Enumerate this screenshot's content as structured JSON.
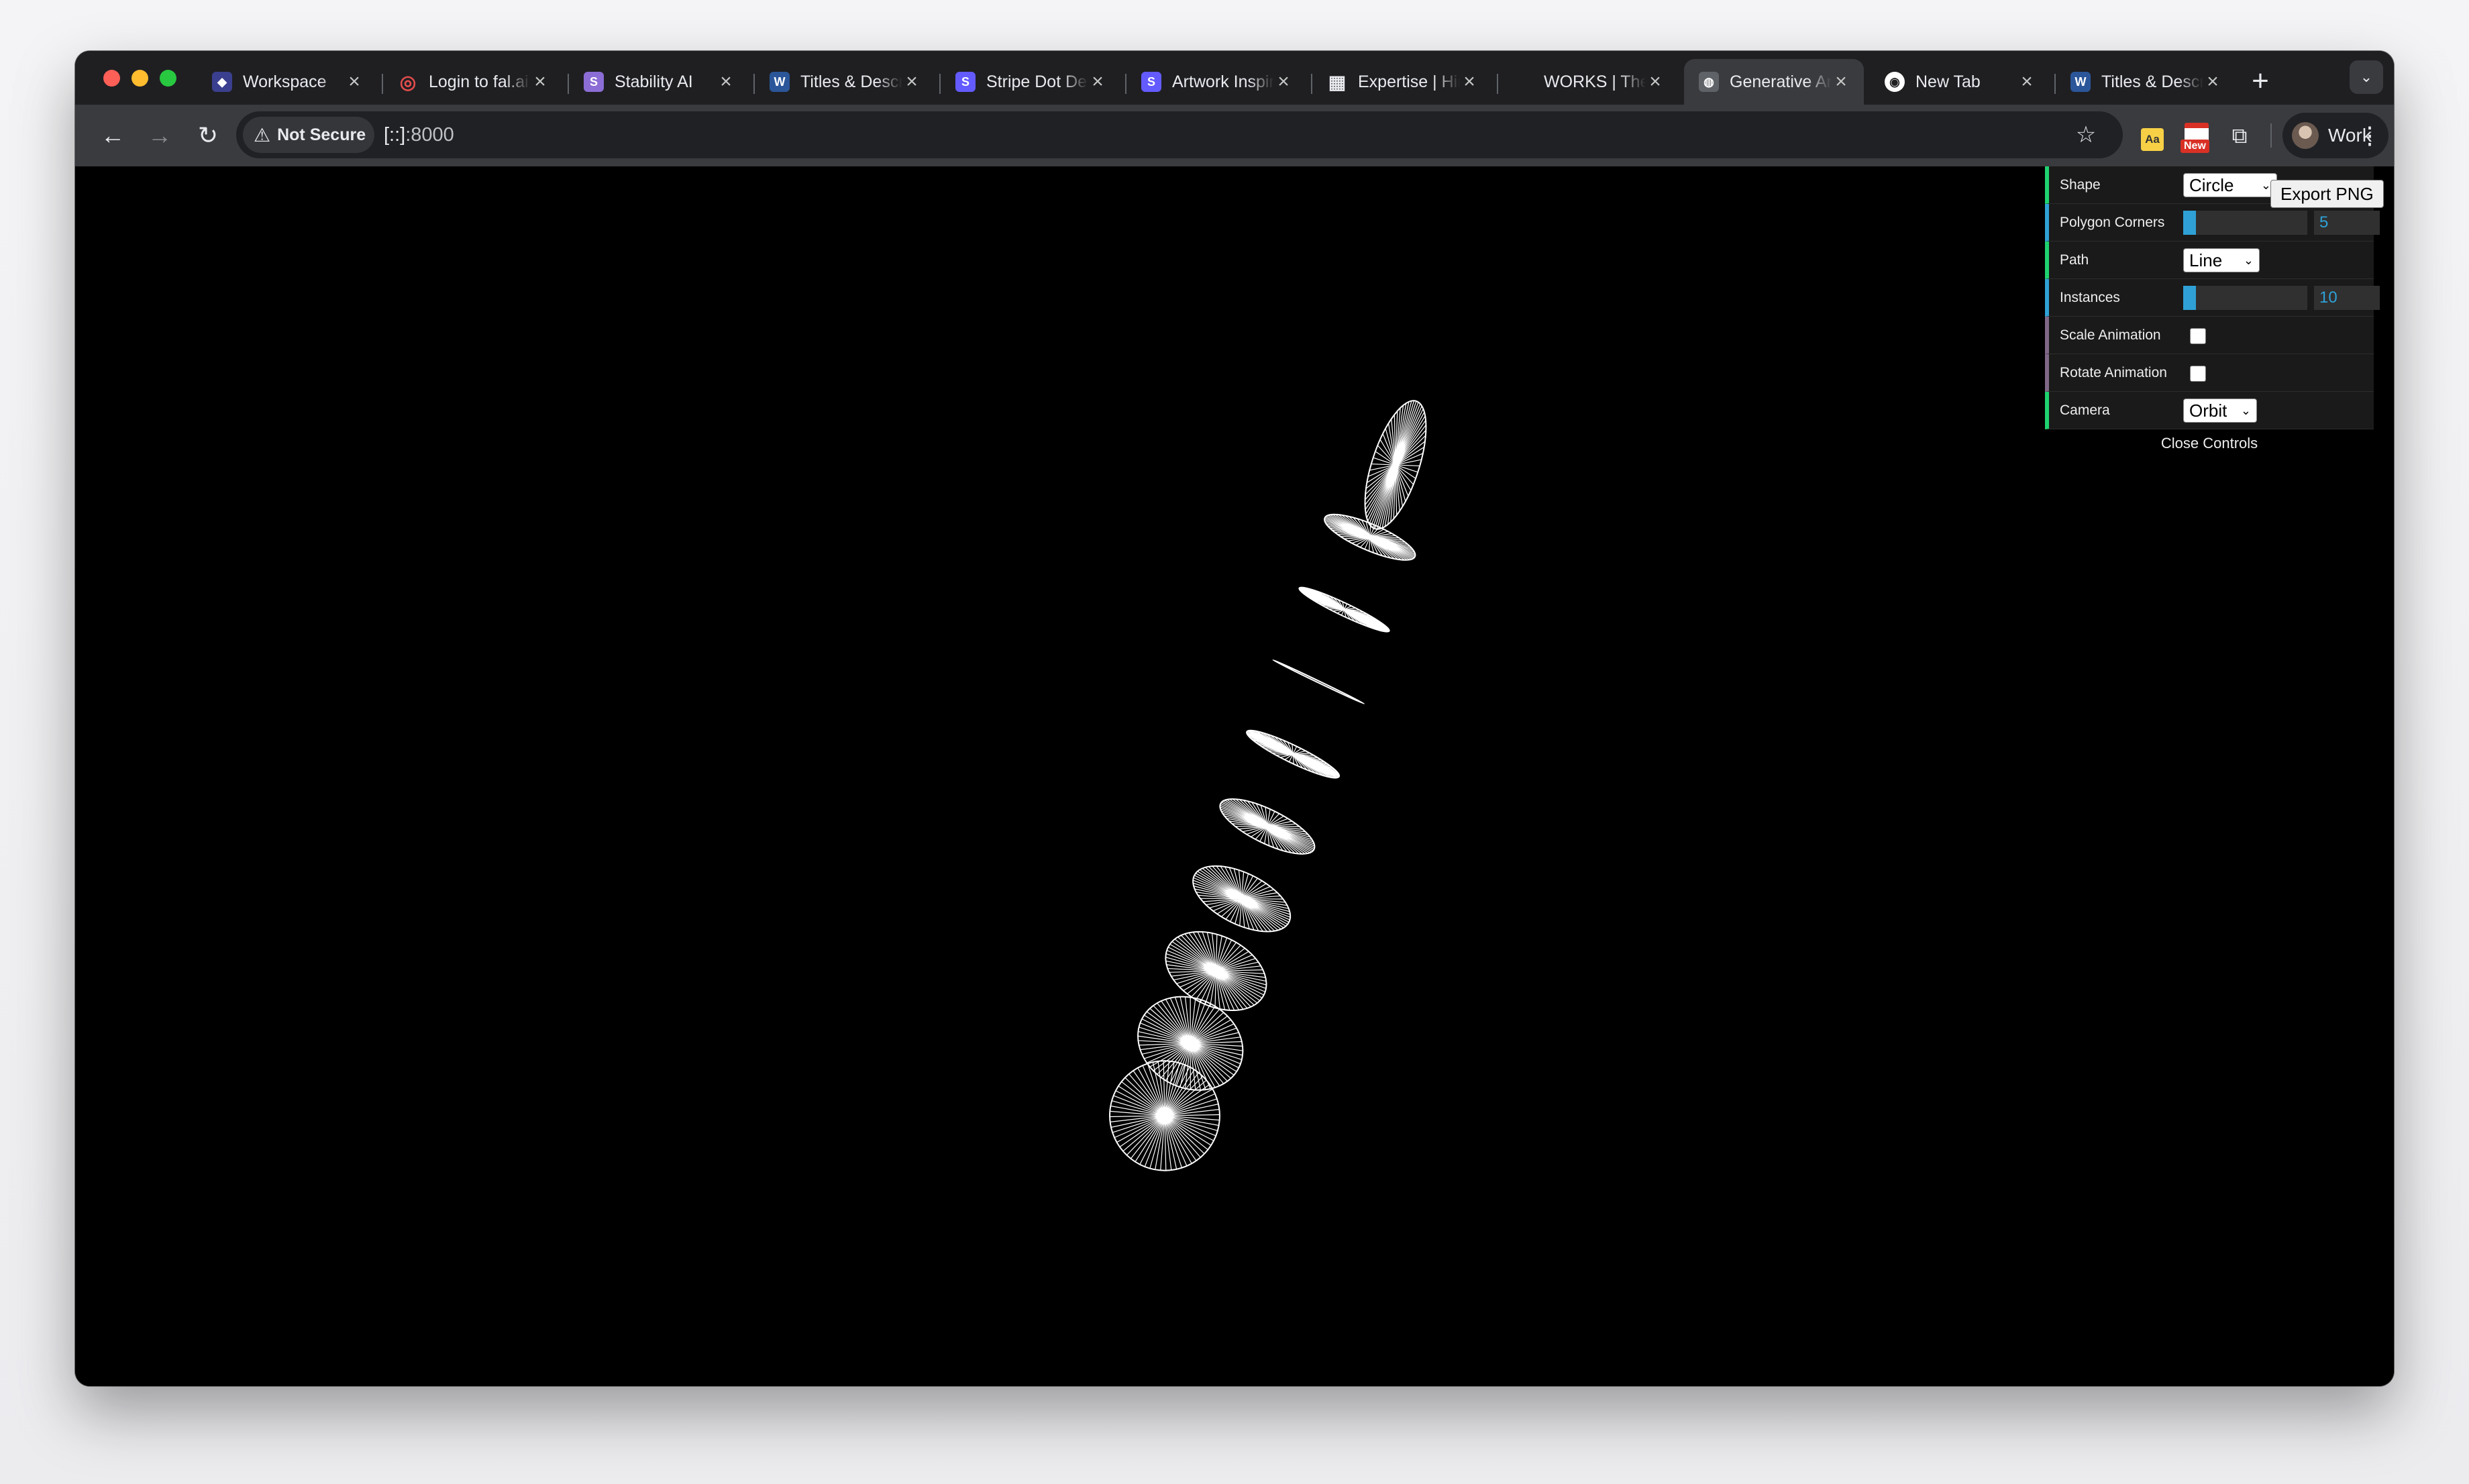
{
  "tabs": [
    {
      "title": "Workspace",
      "icon": "workspace-icon",
      "icon_color": "#3b3f8f",
      "active": false
    },
    {
      "title": "Login to fal.ai",
      "icon": "fal-icon",
      "icon_color": "#e34c4c",
      "active": false
    },
    {
      "title": "Stability AI",
      "icon": "stability-icon",
      "icon_color": "#8c6dd6",
      "active": false
    },
    {
      "title": "Titles & Descriptions",
      "icon": "word-icon",
      "icon_color": "#2b579a",
      "active": false
    },
    {
      "title": "Stripe Dot Dev",
      "icon": "stripe-icon",
      "icon_color": "#635bff",
      "active": false
    },
    {
      "title": "Artwork Inspiration",
      "icon": "stripe-icon",
      "icon_color": "#635bff",
      "active": false
    },
    {
      "title": "Expertise | Hire",
      "icon": "grid-icon",
      "icon_color": "#1f1f22",
      "active": false
    },
    {
      "title": "WORKS | The",
      "icon": "blank-icon",
      "icon_color": "#1f1f22",
      "active": false
    },
    {
      "title": "Generative Art",
      "icon": "globe-icon",
      "icon_color": "#5f6368",
      "active": true
    },
    {
      "title": "New Tab",
      "icon": "chrome-icon",
      "icon_color": "#ffffff",
      "active": false
    },
    {
      "title": "Titles & Descriptions",
      "icon": "word-icon",
      "icon_color": "#2b579a",
      "active": false
    }
  ],
  "toolbar": {
    "security_label": "Not Secure",
    "url_host": "[::]",
    "url_port": ":8000",
    "profile_name": "Work",
    "ext_badge": "New",
    "ext_aa": "Aa"
  },
  "gui": {
    "shape_label": "Shape",
    "shape_value": "Circle",
    "polygon_corners_label": "Polygon Corners",
    "polygon_corners_value": "5",
    "polygon_corners_fraction": 0.1,
    "path_label": "Path",
    "path_value": "Line",
    "instances_label": "Instances",
    "instances_value": "10",
    "instances_fraction": 0.1,
    "scale_animation_label": "Scale Animation",
    "scale_animation_checked": false,
    "rotate_animation_label": "Rotate Animation",
    "rotate_animation_checked": false,
    "camera_label": "Camera",
    "camera_value": "Orbit",
    "close_controls_label": "Close Controls",
    "export_label": "Export PNG"
  },
  "colors": {
    "string_bar": "#1ed36f",
    "number_bar": "#2fa1d6",
    "bool_bar": "#806787",
    "canvas_bg": "#000000",
    "stroke": "#ffffff"
  }
}
